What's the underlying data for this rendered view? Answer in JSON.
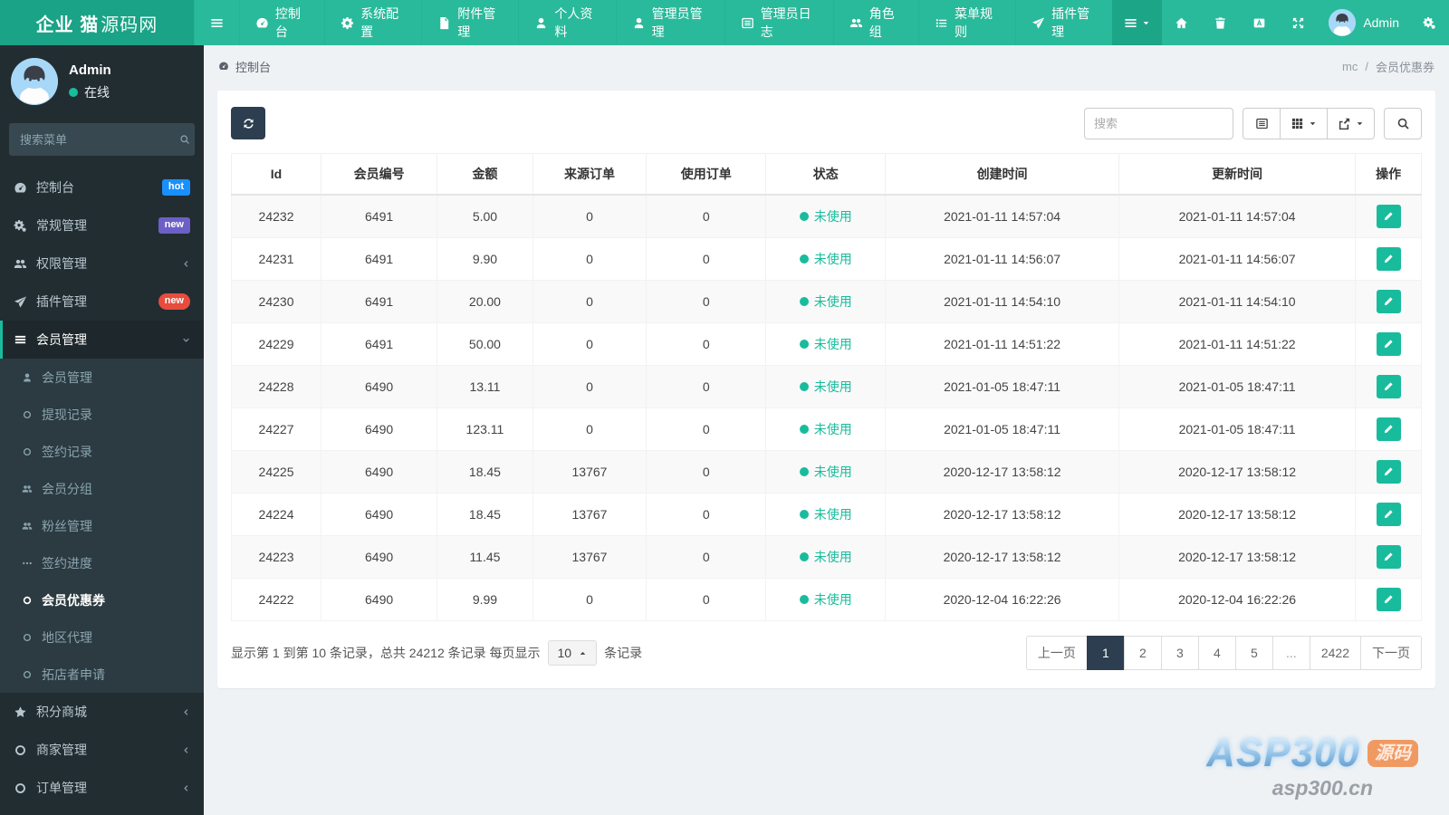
{
  "colors": {
    "accent": "#18bc9c",
    "navbar": "#29ba9b",
    "logo_bg": "#1aa386",
    "sidebar_bg": "#222d32",
    "dark_button": "#2c3e50",
    "badge_hot": "#1890ff",
    "badge_new_purple": "#6c5fc7",
    "badge_new_red": "#e74c3c"
  },
  "topnav": {
    "logo_strong": "企业 猫",
    "logo_light": "源码网",
    "items": [
      {
        "label": "控制台"
      },
      {
        "label": "系统配置"
      },
      {
        "label": "附件管理"
      },
      {
        "label": "个人资料"
      },
      {
        "label": "管理员管理"
      },
      {
        "label": "管理员日志"
      },
      {
        "label": "角色组"
      },
      {
        "label": "菜单规则"
      },
      {
        "label": "插件管理"
      }
    ],
    "admin_label": "Admin"
  },
  "sidebar": {
    "user_name": "Admin",
    "user_status": "在线",
    "search_placeholder": "搜索菜单",
    "items": [
      {
        "label": "控制台",
        "badge": "hot"
      },
      {
        "label": "常规管理",
        "badge": "new"
      },
      {
        "label": "权限管理"
      },
      {
        "label": "插件管理",
        "badge": "new"
      },
      {
        "label": "会员管理"
      }
    ],
    "submenu": [
      {
        "label": "会员管理"
      },
      {
        "label": "提现记录"
      },
      {
        "label": "签约记录"
      },
      {
        "label": "会员分组"
      },
      {
        "label": "粉丝管理"
      },
      {
        "label": "签约进度"
      },
      {
        "label": "会员优惠券"
      },
      {
        "label": "地区代理"
      },
      {
        "label": "拓店者申请"
      }
    ],
    "bottom_items": [
      {
        "label": "积分商城"
      },
      {
        "label": "商家管理"
      },
      {
        "label": "订单管理"
      }
    ]
  },
  "breadcrumb": {
    "left": "控制台",
    "right_parent": "mc",
    "separator": "/",
    "right_current": "会员优惠券"
  },
  "toolbar": {
    "search_placeholder": "搜索"
  },
  "table": {
    "headers": [
      "Id",
      "会员编号",
      "金额",
      "来源订单",
      "使用订单",
      "状态",
      "创建时间",
      "更新时间",
      "操作"
    ],
    "rows": [
      {
        "id": "24232",
        "member_no": "6491",
        "amount": "5.00",
        "source_order": "0",
        "use_order": "0",
        "status": "未使用",
        "created": "2021-01-11 14:57:04",
        "updated": "2021-01-11 14:57:04"
      },
      {
        "id": "24231",
        "member_no": "6491",
        "amount": "9.90",
        "source_order": "0",
        "use_order": "0",
        "status": "未使用",
        "created": "2021-01-11 14:56:07",
        "updated": "2021-01-11 14:56:07"
      },
      {
        "id": "24230",
        "member_no": "6491",
        "amount": "20.00",
        "source_order": "0",
        "use_order": "0",
        "status": "未使用",
        "created": "2021-01-11 14:54:10",
        "updated": "2021-01-11 14:54:10"
      },
      {
        "id": "24229",
        "member_no": "6491",
        "amount": "50.00",
        "source_order": "0",
        "use_order": "0",
        "status": "未使用",
        "created": "2021-01-11 14:51:22",
        "updated": "2021-01-11 14:51:22"
      },
      {
        "id": "24228",
        "member_no": "6490",
        "amount": "13.11",
        "source_order": "0",
        "use_order": "0",
        "status": "未使用",
        "created": "2021-01-05 18:47:11",
        "updated": "2021-01-05 18:47:11"
      },
      {
        "id": "24227",
        "member_no": "6490",
        "amount": "123.11",
        "source_order": "0",
        "use_order": "0",
        "status": "未使用",
        "created": "2021-01-05 18:47:11",
        "updated": "2021-01-05 18:47:11"
      },
      {
        "id": "24225",
        "member_no": "6490",
        "amount": "18.45",
        "source_order": "13767",
        "use_order": "0",
        "status": "未使用",
        "created": "2020-12-17 13:58:12",
        "updated": "2020-12-17 13:58:12"
      },
      {
        "id": "24224",
        "member_no": "6490",
        "amount": "18.45",
        "source_order": "13767",
        "use_order": "0",
        "status": "未使用",
        "created": "2020-12-17 13:58:12",
        "updated": "2020-12-17 13:58:12"
      },
      {
        "id": "24223",
        "member_no": "6490",
        "amount": "11.45",
        "source_order": "13767",
        "use_order": "0",
        "status": "未使用",
        "created": "2020-12-17 13:58:12",
        "updated": "2020-12-17 13:58:12"
      },
      {
        "id": "24222",
        "member_no": "6490",
        "amount": "9.99",
        "source_order": "0",
        "use_order": "0",
        "status": "未使用",
        "created": "2020-12-04 16:22:26",
        "updated": "2020-12-04 16:22:26"
      }
    ]
  },
  "footer": {
    "info_prefix": "显示第 1 到第 10 条记录，总共 24212 条记录 每页显示",
    "page_size": "10",
    "info_suffix": "条记录",
    "pages": [
      "上一页",
      "1",
      "2",
      "3",
      "4",
      "5",
      "...",
      "2422",
      "下一页"
    ]
  },
  "watermark": {
    "title": "ASP300",
    "badge": "源码",
    "domain": "asp300.cn"
  }
}
